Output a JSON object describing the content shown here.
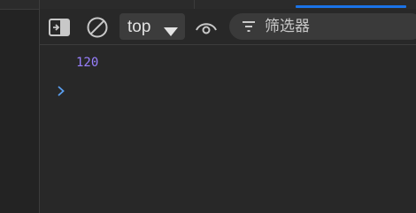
{
  "toolbar": {
    "sidebar_icon": "sidebar-toggle-icon",
    "clear_icon": "clear-console-icon",
    "context": {
      "selected": "top"
    },
    "live_expression_icon": "eye-icon",
    "filter": {
      "placeholder": "筛选器",
      "value": ""
    }
  },
  "console": {
    "entries": [
      {
        "value": "120",
        "type": "number"
      }
    ],
    "prompt_icon": "chevron-right-icon"
  },
  "colors": {
    "background": "#282828",
    "number_value": "#9980ff",
    "prompt": "#5a9ff0",
    "active_tab": "#1a73e8",
    "icon": "#c8c8c8"
  }
}
